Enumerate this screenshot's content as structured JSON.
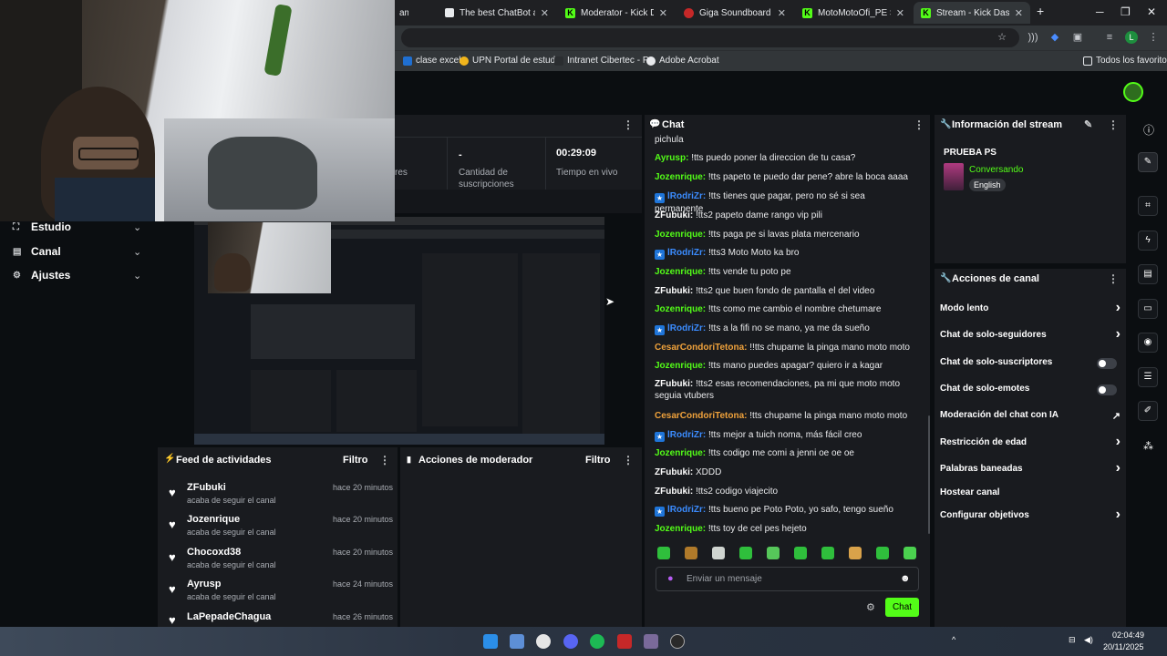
{
  "browser": {
    "tabs": [
      {
        "label": "amos"
      },
      {
        "label": "The best ChatBot and V"
      },
      {
        "label": "Moderator - Kick Dash"
      },
      {
        "label": "Giga Soundboard - Bot"
      },
      {
        "label": "MotoMotoOfi_PE Strea"
      },
      {
        "label": "Stream - Kick Dashboa"
      }
    ],
    "new_tab": "+",
    "bookmarks": [
      {
        "label": "clase excel"
      },
      {
        "label": "UPN Portal de estud..."
      },
      {
        "label": "Intranet Cibertec - P..."
      },
      {
        "label": "Adobe Acrobat"
      }
    ],
    "all_favorites": "Todos los favoritos"
  },
  "stats": {
    "items": [
      {
        "value": "",
        "label": "res"
      },
      {
        "value": "-",
        "label": "Cantidad de suscripciones"
      },
      {
        "value": "00:29:09",
        "label": "Tiempo en vivo"
      }
    ]
  },
  "sidebar": {
    "items": [
      {
        "label": "Estudio"
      },
      {
        "label": "Canal"
      },
      {
        "label": "Ajustes"
      }
    ]
  },
  "feed": {
    "title": "Feed de actividades",
    "filter": "Filtro",
    "items": [
      {
        "name": "ZFubuki",
        "sub": "acaba de seguir el canal",
        "time": "hace 20 minutos"
      },
      {
        "name": "Jozenrique",
        "sub": "acaba de seguir el canal",
        "time": "hace 20 minutos"
      },
      {
        "name": "Chocoxd38",
        "sub": "acaba de seguir el canal",
        "time": "hace 20 minutos"
      },
      {
        "name": "Ayrusp",
        "sub": "acaba de seguir el canal",
        "time": "hace 24 minutos"
      },
      {
        "name": "LaPepadeChagua",
        "sub": "",
        "time": "hace 26 minutos"
      }
    ]
  },
  "moderator": {
    "title": "Acciones de moderador",
    "filter": "Filtro"
  },
  "chat": {
    "title": "Chat",
    "messages": [
      {
        "user": "",
        "text": "pichula",
        "color": "#e9eaec",
        "badge": false
      },
      {
        "user": "Ayrusp:",
        "text": " !tts puedo poner la direccion de tu casa?",
        "color": "#53fc18",
        "badge": false
      },
      {
        "user": "Jozenrique:",
        "text": " !tts papeto te puedo dar pene? abre la boca aaaa",
        "color": "#53fc18",
        "badge": false
      },
      {
        "user": "lRodriZr:",
        "text": " !tts tienes que pagar, pero no sé si sea permanente",
        "color": "#3b8cff",
        "badge": true
      },
      {
        "user": "ZFubuki:",
        "text": " !tts2 papeto dame rango vip pili",
        "color": "#ffffff",
        "badge": false
      },
      {
        "user": "Jozenrique:",
        "text": " !tts paga pe si lavas plata mercenario",
        "color": "#53fc18",
        "badge": false
      },
      {
        "user": "lRodriZr:",
        "text": " !tts3 Moto Moto ka bro",
        "color": "#3b8cff",
        "badge": true
      },
      {
        "user": "Jozenrique:",
        "text": " !tts vende tu poto pe",
        "color": "#53fc18",
        "badge": false
      },
      {
        "user": "ZFubuki:",
        "text": " !tts2 que buen fondo de pantalla el del video",
        "color": "#ffffff",
        "badge": false
      },
      {
        "user": "Jozenrique:",
        "text": " !tts como me cambio el nombre chetumare",
        "color": "#53fc18",
        "badge": false
      },
      {
        "user": "lRodriZr:",
        "text": " !tts a la fifi no se mano, ya me da sueño",
        "color": "#3b8cff",
        "badge": true
      },
      {
        "user": "CesarCondoriTetona:",
        "text": " !!tts chupame la pinga mano moto moto",
        "color": "#f0a23b",
        "badge": false
      },
      {
        "user": "Jozenrique:",
        "text": " !tts mano puedes apagar? quiero ir a kagar",
        "color": "#53fc18",
        "badge": false
      },
      {
        "user": "ZFubuki:",
        "text": " !tts2 esas recomendaciones, pa mi que moto moto seguia vtubers",
        "color": "#ffffff",
        "badge": false
      },
      {
        "user": "CesarCondoriTetona:",
        "text": " !tts chupame la pinga mano moto moto",
        "color": "#f0a23b",
        "badge": false
      },
      {
        "user": "lRodriZr:",
        "text": " !tts mejor a tuich noma, más fácil creo",
        "color": "#3b8cff",
        "badge": true
      },
      {
        "user": "Jozenrique:",
        "text": " !tts codigo me comi a jenni oe oe oe",
        "color": "#53fc18",
        "badge": false
      },
      {
        "user": "ZFubuki:",
        "text": " XDDD",
        "color": "#ffffff",
        "badge": false
      },
      {
        "user": "ZFubuki:",
        "text": " !tts2 codigo viajecito",
        "color": "#ffffff",
        "badge": false
      },
      {
        "user": "lRodriZr:",
        "text": " !tts bueno pe Poto Poto, yo safo, tengo sueño",
        "color": "#3b8cff",
        "badge": true
      },
      {
        "user": "Jozenrique:",
        "text": " !tts toy de cel pes hejeto",
        "color": "#53fc18",
        "badge": false
      }
    ],
    "input_placeholder": "Enviar un mensaje",
    "send_label": "Chat"
  },
  "stream_info": {
    "title": "Información del stream",
    "stream_title": "PRUEBA PS",
    "category": "Conversando",
    "language": "English"
  },
  "channel_actions": {
    "title": "Acciones de canal",
    "items": [
      {
        "label": "Modo lento",
        "control": "arrow"
      },
      {
        "label": "Chat de solo-seguidores",
        "control": "arrow"
      },
      {
        "label": "Chat de solo-suscriptores",
        "control": "toggle"
      },
      {
        "label": "Chat de solo-emotes",
        "control": "toggle"
      },
      {
        "label": "Moderación del chat con IA",
        "control": "external"
      },
      {
        "label": "Restricción de edad",
        "control": "arrow"
      },
      {
        "label": "Palabras baneadas",
        "control": "arrow"
      },
      {
        "label": "Hostear canal",
        "control": "none"
      },
      {
        "label": "Configurar objetivos",
        "control": "arrow"
      }
    ]
  },
  "taskbar": {
    "time": "02:04:49",
    "date": "20/11/2025"
  },
  "colors": {
    "accent": "#53fc18",
    "panel": "#191b1f",
    "background": "#0b0e11"
  }
}
